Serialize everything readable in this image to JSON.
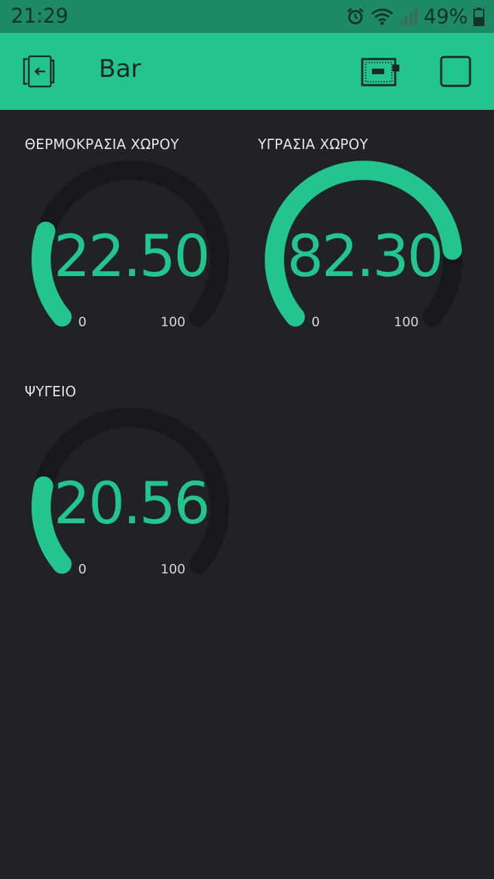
{
  "status_bar": {
    "time": "21:29",
    "battery_percent": "49%",
    "icons": [
      "alarm-icon",
      "wifi-icon",
      "signal-icon",
      "battery-icon"
    ]
  },
  "app_bar": {
    "title": "Bar",
    "icons": [
      "exit-icon",
      "device-icon",
      "stop-icon"
    ]
  },
  "colors": {
    "accent": "#23c48e",
    "status_bar": "#1d8a63",
    "background": "#212227",
    "track": "#17181b"
  },
  "gauges": [
    {
      "label": "ΘΕΡΜΟΚΡΑΣΙΑ ΧΩΡΟΥ",
      "value": "22.50",
      "level": 0.225,
      "min": "0",
      "max": "100"
    },
    {
      "label": "ΥΓΡΑΣΙΑ ΧΩΡΟΥ",
      "value": "82.30",
      "level": 0.823,
      "min": "0",
      "max": "100"
    },
    {
      "label": "ΨΥΓΕΙΟ",
      "value": "20.56",
      "level": 0.2056,
      "min": "0",
      "max": "100"
    }
  ]
}
